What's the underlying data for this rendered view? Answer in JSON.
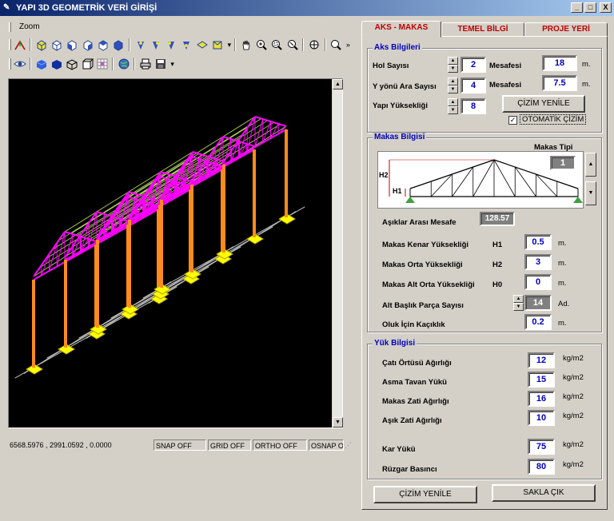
{
  "window": {
    "title": "YAPI 3D GEOMETRİK VERİ GİRİŞİ",
    "minimize": "_",
    "maximize": "□",
    "close": "X"
  },
  "menu": {
    "zoom": "Zoom"
  },
  "toolbar_icons": [
    "axes-icon",
    "view-front-icon",
    "view-back-icon",
    "view-left-icon",
    "view-right-icon",
    "view-top-icon",
    "view-bottom-icon",
    "iso-sw-icon",
    "iso-se-icon",
    "iso-ne-icon",
    "iso-nw-icon",
    "shade-icon",
    "render-icon",
    "pan-hand-icon",
    "zoom-realtime-icon",
    "zoom-window-icon",
    "zoom-extents-icon",
    "zoom-in-icon",
    "eye-icon",
    "solid-blue-icon",
    "solid-dark-icon",
    "wire-icon",
    "box-icon",
    "grid-icon",
    "globe-icon",
    "printer-icon",
    "save-icon"
  ],
  "status": {
    "coords": "6568.5976 , 2991.0592 , 0.0000",
    "snap": "SNAP OFF",
    "grid": "GRID OFF",
    "ortho": "ORTHO OFF",
    "osnap": "OSNAP O"
  },
  "tabs": [
    {
      "label": "AKS - MAKAS",
      "active": true
    },
    {
      "label": "TEMEL BİLGİ",
      "active": false
    },
    {
      "label": "PROJE YERİ",
      "active": false
    }
  ],
  "aks": {
    "title": "Aks Bilgileri",
    "hol_label": "Hol Sayısı",
    "hol_value": "2",
    "y_label": "Y yönü Ara Sayısı",
    "y_value": "4",
    "height_label": "Yapı Yüksekliği",
    "height_value": "8",
    "mesafe1_label": "Mesafesi",
    "mesafe1_value": "18",
    "mesafe1_unit": "m.",
    "mesafe2_label": "Mesafesi",
    "mesafe2_value": "7.5",
    "mesafe2_unit": "m.",
    "redraw_button": "ÇİZİM YENİLE",
    "auto_draw_label": "OTOMATİK ÇİZİM",
    "auto_draw_checked": "✓"
  },
  "makas": {
    "title": "Makas Bilgisi",
    "type_label": "Makas Tipi",
    "type_value": "1",
    "h1": "H1",
    "h2": "H2",
    "asik_label": "Aşıklar Arası Mesafe",
    "asik_value": "128.57",
    "rows": [
      {
        "label": "Makas Kenar Yüksekliği",
        "code": "H1",
        "value": "0.5",
        "unit": "m."
      },
      {
        "label": "Makas Orta Yüksekliği",
        "code": "H2",
        "value": "3",
        "unit": "m."
      },
      {
        "label": "Makas Alt Orta Yüksekliği",
        "code": "H0",
        "value": "0",
        "unit": "m."
      }
    ],
    "parca_label": "Alt Başlık Parça Sayısı",
    "parca_value": "14",
    "parca_unit": "Ad.",
    "oluk_label": "Oluk İçin Kaçıklık",
    "oluk_value": "0.2",
    "oluk_unit": "m."
  },
  "yuk": {
    "title": "Yük Bilgisi",
    "rows": [
      {
        "label": "Çatı Örtüsü Ağırlığı",
        "value": "12",
        "unit": "kg/m2"
      },
      {
        "label": "Asma Tavan Yükü",
        "value": "15",
        "unit": "kg/m2"
      },
      {
        "label": "Makas Zati Ağırlığı",
        "value": "16",
        "unit": "kg/m2"
      },
      {
        "label": "Aşık Zati Ağırlığı",
        "value": "10",
        "unit": "kg/m2"
      },
      {
        "label": "Kar Yükü",
        "value": "75",
        "unit": "kg/m2"
      },
      {
        "label": "Rüzgar Basıncı",
        "value": "80",
        "unit": "kg/m2"
      }
    ]
  },
  "footer": {
    "redraw": "ÇİZİM YENİLE",
    "save_exit": "SAKLA ÇIK"
  },
  "colors": {
    "truss": "#ff00ff",
    "column": "#ff8c1a",
    "footing": "#ffff00",
    "purlin": "#b8e060",
    "grid": "#c0c0c0",
    "tab_text": "#c00000",
    "field_text": "#0000c0"
  }
}
